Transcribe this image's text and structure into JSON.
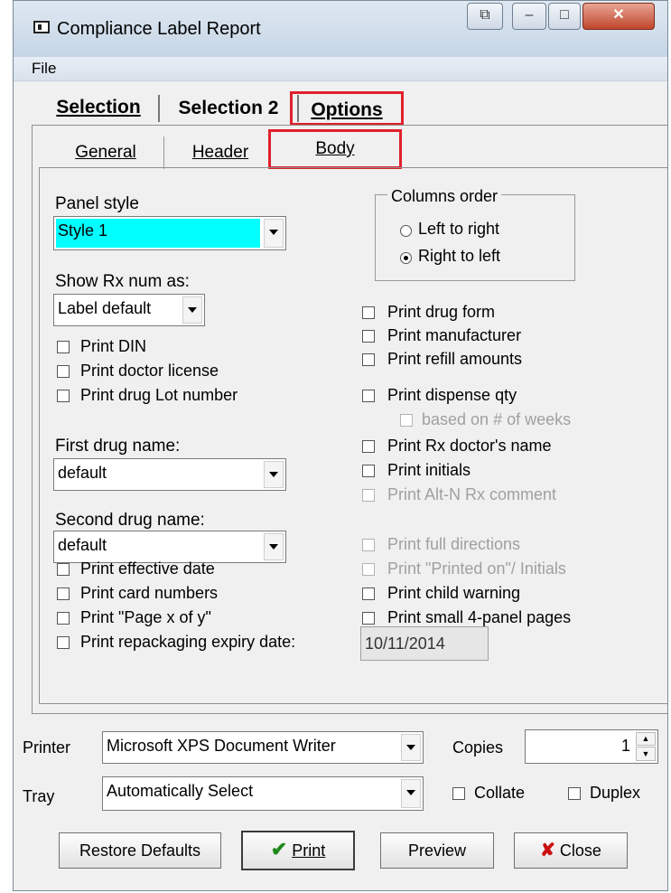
{
  "window": {
    "title": "Compliance Label Report"
  },
  "menu": {
    "file": "File"
  },
  "tabs": {
    "selection": "Selection",
    "selection2": "Selection 2",
    "options": "Options"
  },
  "subtabs": {
    "general": "General",
    "header": "Header",
    "body": "Body"
  },
  "panel_style": {
    "label": "Panel style",
    "value": "Style 1",
    "highlight": "#00ffff"
  },
  "show_rx": {
    "label": "Show Rx num as:",
    "value": "Label default"
  },
  "columns_order": {
    "title": "Columns order",
    "left_to_right": "Left to right",
    "right_to_left": "Right to left",
    "selected": "right_to_left"
  },
  "left_checks": {
    "print_din": "Print DIN",
    "print_doctor_license": "Print doctor license",
    "print_drug_lot": "Print drug Lot number"
  },
  "first_drug": {
    "label": "First drug name:",
    "value": "default"
  },
  "second_drug": {
    "label": "Second drug name:",
    "value": "default"
  },
  "bottom_left_checks": {
    "print_effective_date": "Print effective date",
    "print_card_numbers": "Print card numbers",
    "print_page_x_of_y": "Print \"Page x of y\"",
    "print_repackaging": "Print repackaging expiry date:"
  },
  "expiry_date": "10/11/2014",
  "right_checks": {
    "print_drug_form": "Print drug form",
    "print_manufacturer": "Print manufacturer",
    "print_refill_amounts": "Print refill amounts",
    "print_dispense_qty": "Print dispense qty",
    "based_on_weeks": "based on # of weeks",
    "print_rx_doctor": "Print Rx doctor's name",
    "print_initials": "Print initials",
    "print_altn": "Print Alt-N Rx comment",
    "print_full_directions": "Print full directions",
    "print_printed_on": "Print \"Printed on\"/ Initials",
    "print_child_warning": "Print child warning",
    "print_small_4panel": "Print small 4-panel pages"
  },
  "printer": {
    "label": "Printer",
    "value": "Microsoft XPS Document Writer"
  },
  "copies": {
    "label": "Copies",
    "value": "1"
  },
  "tray": {
    "label": "Tray",
    "value": "Automatically Select"
  },
  "collate": "Collate",
  "duplex": "Duplex",
  "buttons": {
    "restore": "Restore Defaults",
    "print": "Print",
    "preview": "Preview",
    "close": "Close"
  },
  "colors": {
    "highlight_border": "#e0202c",
    "check_green": "#1e8a1e",
    "close_x": "#cc1111"
  }
}
